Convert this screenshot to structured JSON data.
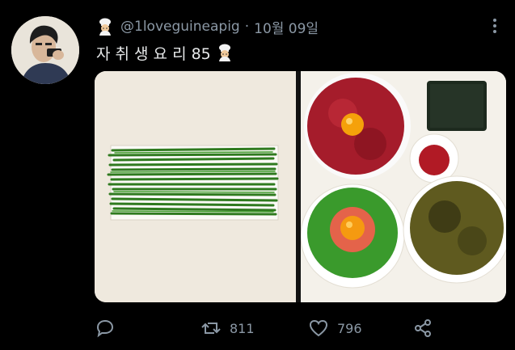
{
  "tweet": {
    "handle": "@1loveguineapig",
    "separator": "·",
    "date": "10월 09일",
    "text": "자 취 생 요 리 85"
  },
  "icons": {
    "chef": "chef-emoji-icon",
    "more": "more-options-icon",
    "reply": "reply-icon",
    "retweet": "retweet-icon",
    "like": "heart-icon",
    "share": "share-icon"
  },
  "actions": {
    "retweets": "811",
    "likes": "796"
  },
  "colors": {
    "background": "#000000",
    "text": "#e7e9ea",
    "muted": "#8b98a5"
  }
}
